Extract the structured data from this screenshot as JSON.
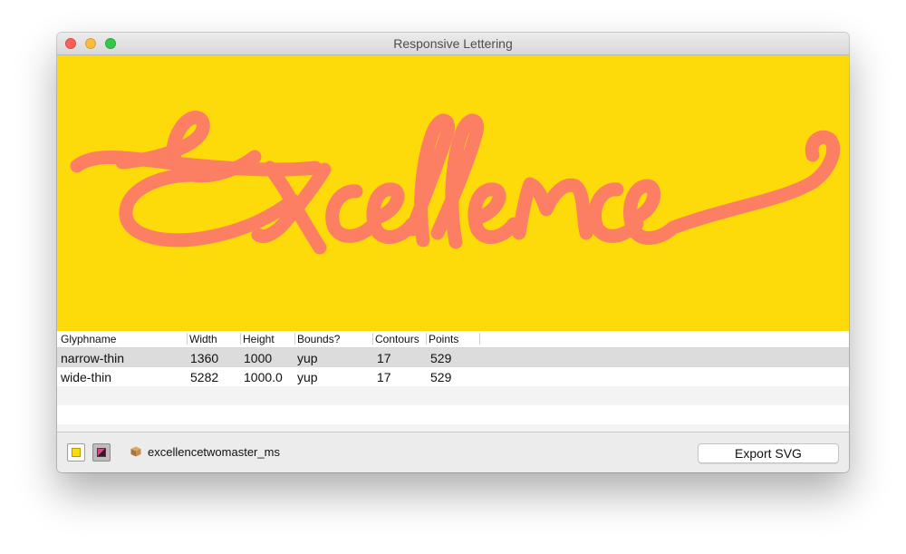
{
  "window": {
    "title": "Responsive Lettering"
  },
  "preview": {
    "background_color": "#fddb0a",
    "lettering_color": "#fd7f63",
    "artwork_text": "Excellence"
  },
  "table": {
    "columns": [
      "Glyphname",
      "Width",
      "Height",
      "Bounds?",
      "Contours",
      "Points"
    ],
    "rows": [
      {
        "glyphname": "narrow-thin",
        "width": "1360",
        "height": "1000",
        "bounds": "yup",
        "contours": "17",
        "points": "529"
      },
      {
        "glyphname": "wide-thin",
        "width": "5282",
        "height": "1000.0",
        "bounds": "yup",
        "contours": "17",
        "points": "529"
      }
    ]
  },
  "bottom_bar": {
    "fill_swatch_icon": "yellow-swatch-icon",
    "gradient_swatch_icon": "pink-swatch-icon",
    "font_icon": "font-file-icon",
    "font_name": "excellencetwomaster_ms",
    "export_label": "Export SVG"
  }
}
